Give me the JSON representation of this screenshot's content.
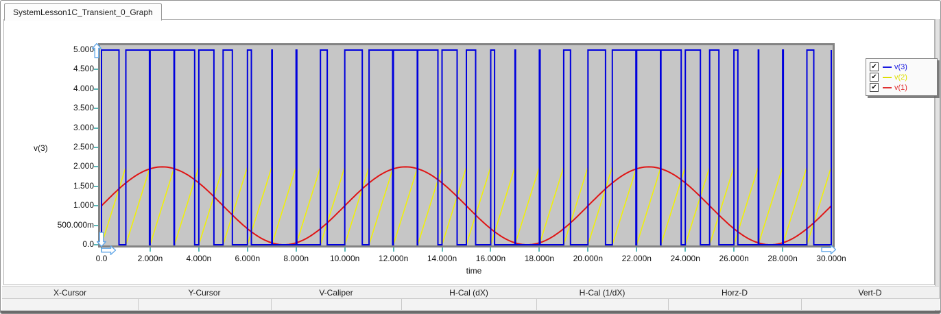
{
  "window": {
    "tab_title": "SystemLesson1C_Transient_0_Graph"
  },
  "axes": {
    "y_label": "v(3)",
    "x_label": "time",
    "y_ticks": [
      {
        "label": "5.000",
        "v": 5
      },
      {
        "label": "4.500",
        "v": 4.5
      },
      {
        "label": "4.000",
        "v": 4
      },
      {
        "label": "3.500",
        "v": 3.5
      },
      {
        "label": "3.000",
        "v": 3
      },
      {
        "label": "2.500",
        "v": 2.5
      },
      {
        "label": "2.000",
        "v": 2
      },
      {
        "label": "1.500",
        "v": 1.5
      },
      {
        "label": "1.000",
        "v": 1
      },
      {
        "label": "500.000m",
        "v": 0.5
      },
      {
        "label": "0.0",
        "v": 0
      }
    ],
    "x_ticks": [
      {
        "label": "0.0",
        "t": 0
      },
      {
        "label": "2.000n",
        "t": 2
      },
      {
        "label": "4.000n",
        "t": 4
      },
      {
        "label": "6.000n",
        "t": 6
      },
      {
        "label": "8.000n",
        "t": 8
      },
      {
        "label": "10.000n",
        "t": 10
      },
      {
        "label": "12.000n",
        "t": 12
      },
      {
        "label": "14.000n",
        "t": 14
      },
      {
        "label": "16.000n",
        "t": 16
      },
      {
        "label": "18.000n",
        "t": 18
      },
      {
        "label": "20.000n",
        "t": 20
      },
      {
        "label": "22.000n",
        "t": 22
      },
      {
        "label": "24.000n",
        "t": 24
      },
      {
        "label": "26.000n",
        "t": 26
      },
      {
        "label": "28.000n",
        "t": 28
      },
      {
        "label": "30.000n",
        "t": 30
      }
    ]
  },
  "legend": {
    "items": [
      {
        "label": "v(3)",
        "color": "#1a1ae0",
        "checked": true
      },
      {
        "label": "v(2)",
        "color": "#dede00",
        "checked": true
      },
      {
        "label": "v(1)",
        "color": "#e03030",
        "checked": true
      }
    ]
  },
  "measure_bar": {
    "fields": [
      {
        "label": "X-Cursor",
        "value": ""
      },
      {
        "label": "Y-Cursor",
        "value": ""
      },
      {
        "label": "V-Caliper",
        "value": ""
      },
      {
        "label": "H-Cal (dX)",
        "value": ""
      },
      {
        "label": "H-Cal (1/dX)",
        "value": ""
      },
      {
        "label": "Horz-D",
        "value": ""
      },
      {
        "label": "Vert-D",
        "value": ""
      }
    ]
  },
  "chart_data": {
    "type": "line",
    "title": "",
    "xlabel": "time",
    "ylabel": "v(3)",
    "x_range_ns": [
      0,
      30
    ],
    "y_range_V": [
      0,
      5
    ],
    "grid": false,
    "legend_position": "top-right",
    "plot_bg": "#c6c6c6",
    "series": [
      {
        "name": "v(3)",
        "kind": "pwm-square",
        "color": "#0000dd",
        "low_V": 0,
        "high_V": 5,
        "high_intervals_ns": [
          [
            0,
            0.72
          ],
          [
            1,
            1.97
          ],
          [
            2,
            2.98
          ],
          [
            3,
            3.83
          ],
          [
            4,
            4.62
          ],
          [
            5,
            5.38
          ],
          [
            6,
            6.16
          ],
          [
            7,
            7.02
          ],
          [
            8,
            8.03
          ],
          [
            9,
            9.28
          ],
          [
            10,
            10.72
          ],
          [
            11,
            11.97
          ],
          [
            12,
            12.98
          ],
          [
            13,
            13.83
          ],
          [
            14,
            14.62
          ],
          [
            15,
            15.38
          ],
          [
            16,
            16.16
          ],
          [
            17,
            17.02
          ],
          [
            18,
            18.03
          ],
          [
            19,
            19.28
          ],
          [
            20,
            20.72
          ],
          [
            21,
            21.97
          ],
          [
            22,
            22.98
          ],
          [
            23,
            23.83
          ],
          [
            24,
            24.62
          ],
          [
            25,
            25.38
          ],
          [
            26,
            26.16
          ],
          [
            27,
            27.02
          ],
          [
            28,
            28.03
          ],
          [
            29,
            29.28
          ]
        ],
        "rises_at_end_ns": 30
      },
      {
        "name": "v(2)",
        "kind": "sawtooth",
        "color": "#f0f00a",
        "min_V": 0,
        "max_V": 2,
        "period_ns": 1,
        "dark_reset_times_ns": [
          1,
          4,
          5,
          6,
          7,
          8,
          9,
          10,
          11,
          14,
          15,
          16,
          17,
          18,
          19,
          20,
          21,
          24,
          25,
          26,
          27,
          28,
          29
        ],
        "dark_reset_color": "#8c8c80"
      },
      {
        "name": "v(1)",
        "kind": "sine",
        "color": "#e01414",
        "offset_V": 1,
        "amplitude_V": 1,
        "period_ns": 10,
        "phase_deg": 0
      }
    ]
  },
  "ui_colors": {
    "plot_bg": "#c6c6c6",
    "plot_border": "#838383",
    "tick_color": "#5cb8b8",
    "cursor_handle": "#64a8e8"
  }
}
